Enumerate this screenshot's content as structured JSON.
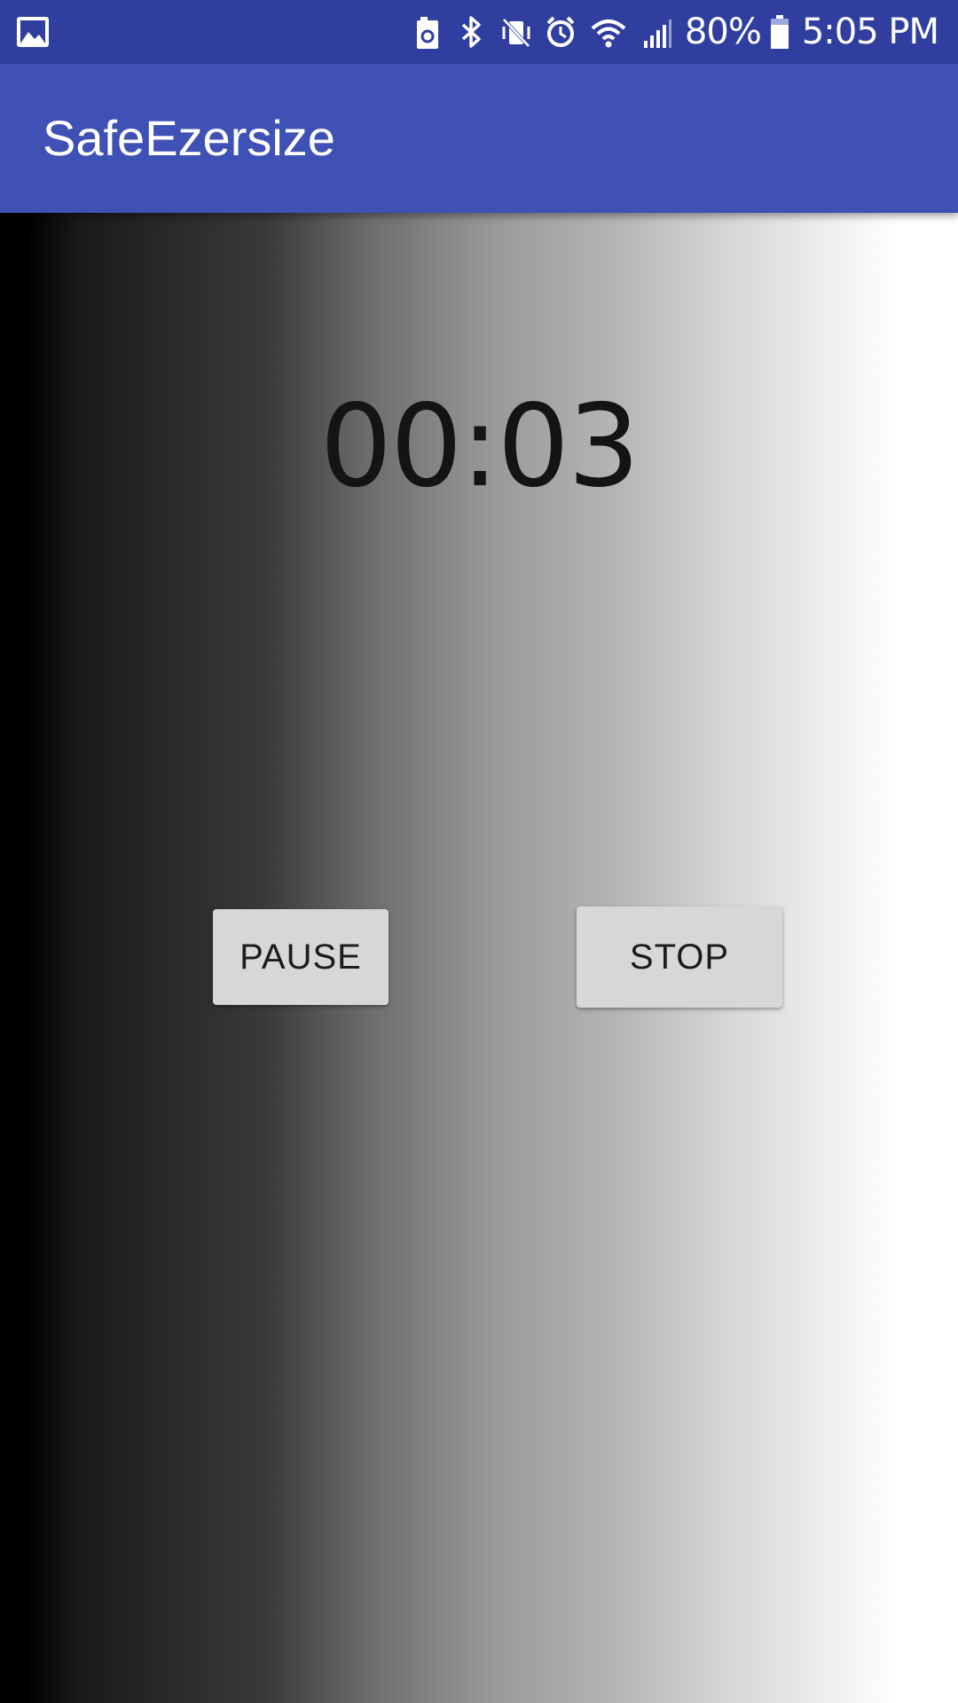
{
  "status_bar": {
    "icons": [
      "gallery-icon",
      "battery-saver-icon",
      "bluetooth-icon",
      "vibrate-icon",
      "alarm-icon",
      "wifi-icon",
      "cell-signal-icon",
      "battery-icon"
    ],
    "battery": "80%",
    "time": "5:05 PM",
    "background": "#303f9f"
  },
  "app_bar": {
    "title": "SafeEzersize",
    "background": "#3f51b5"
  },
  "timer": {
    "display": "00:03"
  },
  "buttons": {
    "pause_label": "PAUSE",
    "stop_label": "STOP"
  }
}
